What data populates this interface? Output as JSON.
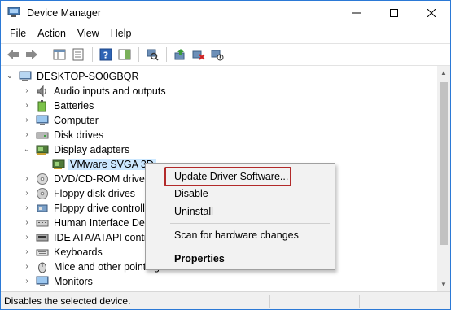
{
  "window": {
    "title": "Device Manager"
  },
  "menu": [
    "File",
    "Action",
    "View",
    "Help"
  ],
  "tree": {
    "root": "DESKTOP-SO0GBQR",
    "items": [
      "Audio inputs and outputs",
      "Batteries",
      "Computer",
      "Disk drives",
      "Display adapters",
      "VMware SVGA 3D",
      "DVD/CD-ROM drives",
      "Floppy disk drives",
      "Floppy drive controlle",
      "Human Interface Dev",
      "IDE ATA/ATAPI contro",
      "Keyboards",
      "Mice and other pointing",
      "Monitors"
    ]
  },
  "context_menu": {
    "update": "Update Driver Software...",
    "disable": "Disable",
    "uninstall": "Uninstall",
    "scan": "Scan for hardware changes",
    "properties": "Properties"
  },
  "status": "Disables the selected device.",
  "colors": {
    "accent": "#2b79d6",
    "selection": "#cce8ff",
    "highlight_box": "#b22a2a"
  }
}
